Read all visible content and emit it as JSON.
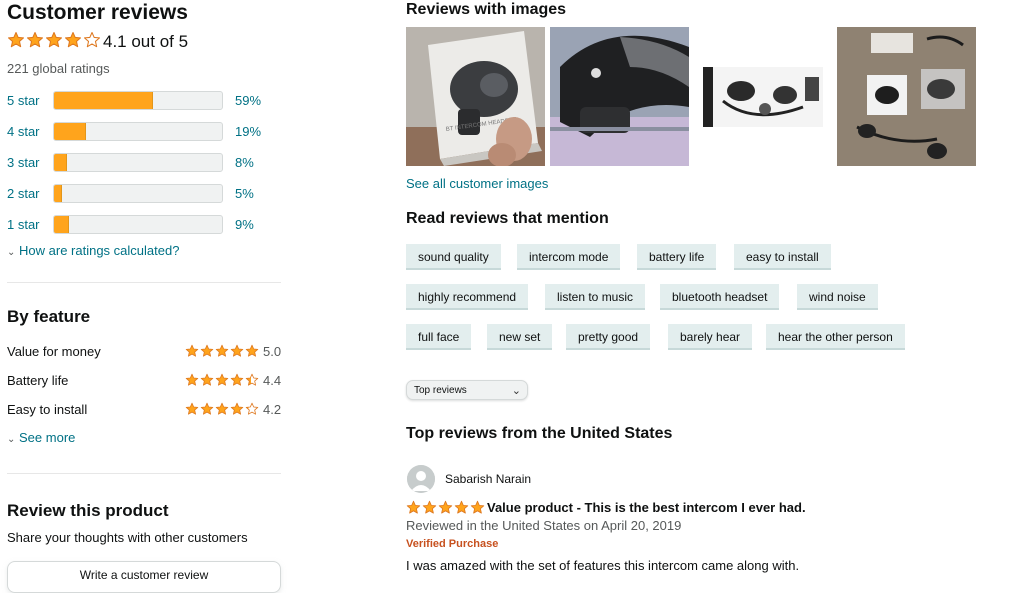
{
  "left": {
    "title": "Customer reviews",
    "rating_value": 4.1,
    "rating_text": "4.1 out of 5",
    "global_ratings": "221 global ratings",
    "histogram": [
      {
        "label": "5 star",
        "percent": 59,
        "percent_text": "59%"
      },
      {
        "label": "4 star",
        "percent": 19,
        "percent_text": "19%"
      },
      {
        "label": "3 star",
        "percent": 8,
        "percent_text": "8%"
      },
      {
        "label": "2 star",
        "percent": 5,
        "percent_text": "5%"
      },
      {
        "label": "1 star",
        "percent": 9,
        "percent_text": "9%"
      }
    ],
    "how_calculated": "How are ratings calculated?",
    "by_feature": {
      "title": "By feature",
      "items": [
        {
          "name": "Value for money",
          "rating": 5.0,
          "value_text": "5.0"
        },
        {
          "name": "Battery life",
          "rating": 4.4,
          "value_text": "4.4"
        },
        {
          "name": "Easy to install",
          "rating": 4.2,
          "value_text": "4.2"
        }
      ],
      "see_more": "See more"
    },
    "review_product": {
      "title": "Review this product",
      "subtitle": "Share your thoughts with other customers",
      "button": "Write a customer review"
    }
  },
  "right": {
    "images_title": "Reviews with images",
    "see_all_images": "See all customer images",
    "mentions_title": "Read reviews that mention",
    "chips": [
      [
        "sound quality",
        "intercom mode",
        "battery life",
        "easy to install"
      ],
      [
        "highly recommend",
        "listen to music",
        "bluetooth headset",
        "wind noise"
      ],
      [
        "full face",
        "new set",
        "pretty good",
        "barely hear",
        "hear the other person"
      ]
    ],
    "sort_select": "Top reviews",
    "top_reviews_title": "Top reviews from the United States",
    "review": {
      "author": "Sabarish Narain",
      "rating": 5,
      "title": "Value product - This is the best intercom I ever had.",
      "meta": "Reviewed in the United States on April 20, 2019",
      "verified": "Verified Purchase",
      "body": "I was amazed with the set of features this intercom came along with."
    },
    "thumb_labels": {
      "box": "BT INTERCOM HEADSET"
    }
  },
  "colors": {
    "star": "#ffa41c",
    "link": "#007185",
    "verified": "#c7511f",
    "chip_bg": "#e3eeee"
  }
}
